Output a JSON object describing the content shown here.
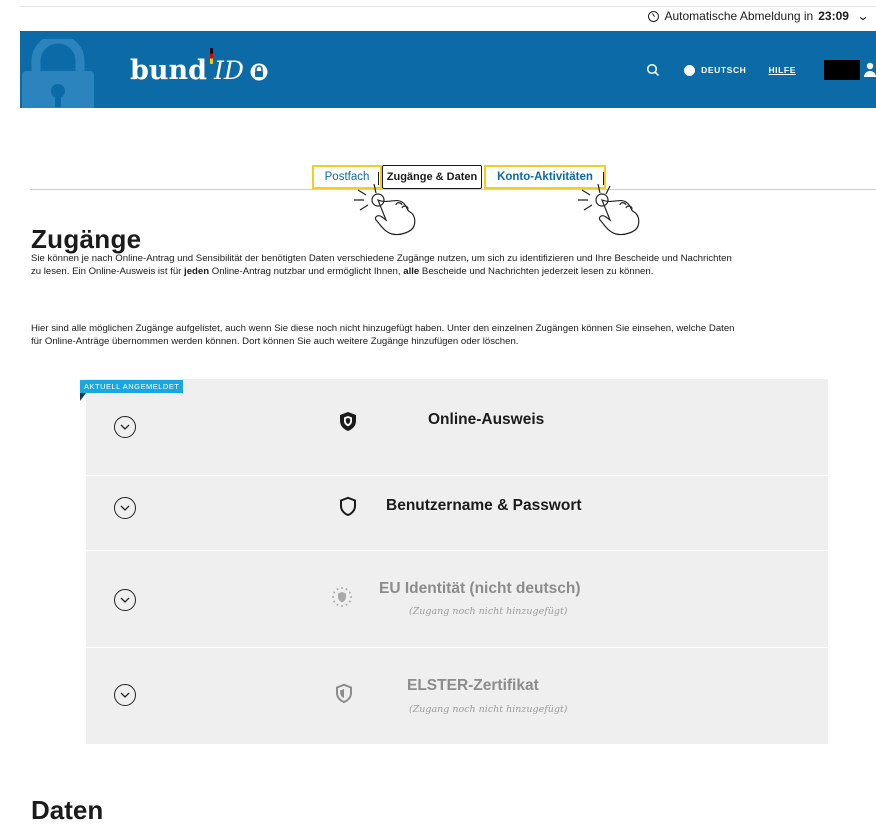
{
  "session": {
    "logout_label": "Automatische Abmeldung in",
    "logout_time": "23:09"
  },
  "header": {
    "brand": "bund",
    "brand_id": "ID",
    "language": "DEUTSCH",
    "help": "HILFE",
    "colors": {
      "primary": "#0c6aa6",
      "highlight": "#f2cd25",
      "badge": "#1aa6e0"
    }
  },
  "tabs": {
    "postfach": "Postfach",
    "zugaenge": "Zugänge & Daten",
    "konto": "Konto-Aktivitäten"
  },
  "page": {
    "title": "Zugänge",
    "intro1_a": "Sie können je nach Online-Antrag und Sensibilität der benötigten Daten verschiedene Zugänge nutzen, um sich zu identifizieren und Ihre Bescheide und Nachrichten",
    "intro1_b1": "zu lesen. Ein Online-Ausweis ist für ",
    "intro1_b_bold1": "jeden",
    "intro1_b2": " Online-Antrag nutzbar und ermöglicht Ihnen, ",
    "intro1_b_bold2": "alle",
    "intro1_b3": " Bescheide und Nachrichten jederzeit lesen zu können.",
    "intro2_a": "Hier sind alle möglichen Zugänge aufgelistet, auch wenn Sie diese noch nicht hinzugefügt haben. Unter den einzelnen Zugängen können Sie einsehen, welche Daten",
    "intro2_b": "für Online-Anträge übernommen werden können. Dort können Sie auch weitere Zugänge hinzufügen oder löschen.",
    "badge": "AKTUELL ANGEMELDET",
    "next_section": "Daten"
  },
  "access": [
    {
      "title": "Online-Ausweis",
      "icon": "shield-filled-icon"
    },
    {
      "title": "Benutzername & Passwort",
      "icon": "shield-outline-icon"
    },
    {
      "title": "EU Identität (nicht deutsch)",
      "subtitle": "(Zugang noch nicht hinzugefügt)",
      "icon": "eu-shield-icon"
    },
    {
      "title": "ELSTER-Zertifikat",
      "subtitle": "(Zugang noch nicht hinzugefügt)",
      "icon": "elster-shield-icon"
    }
  ]
}
